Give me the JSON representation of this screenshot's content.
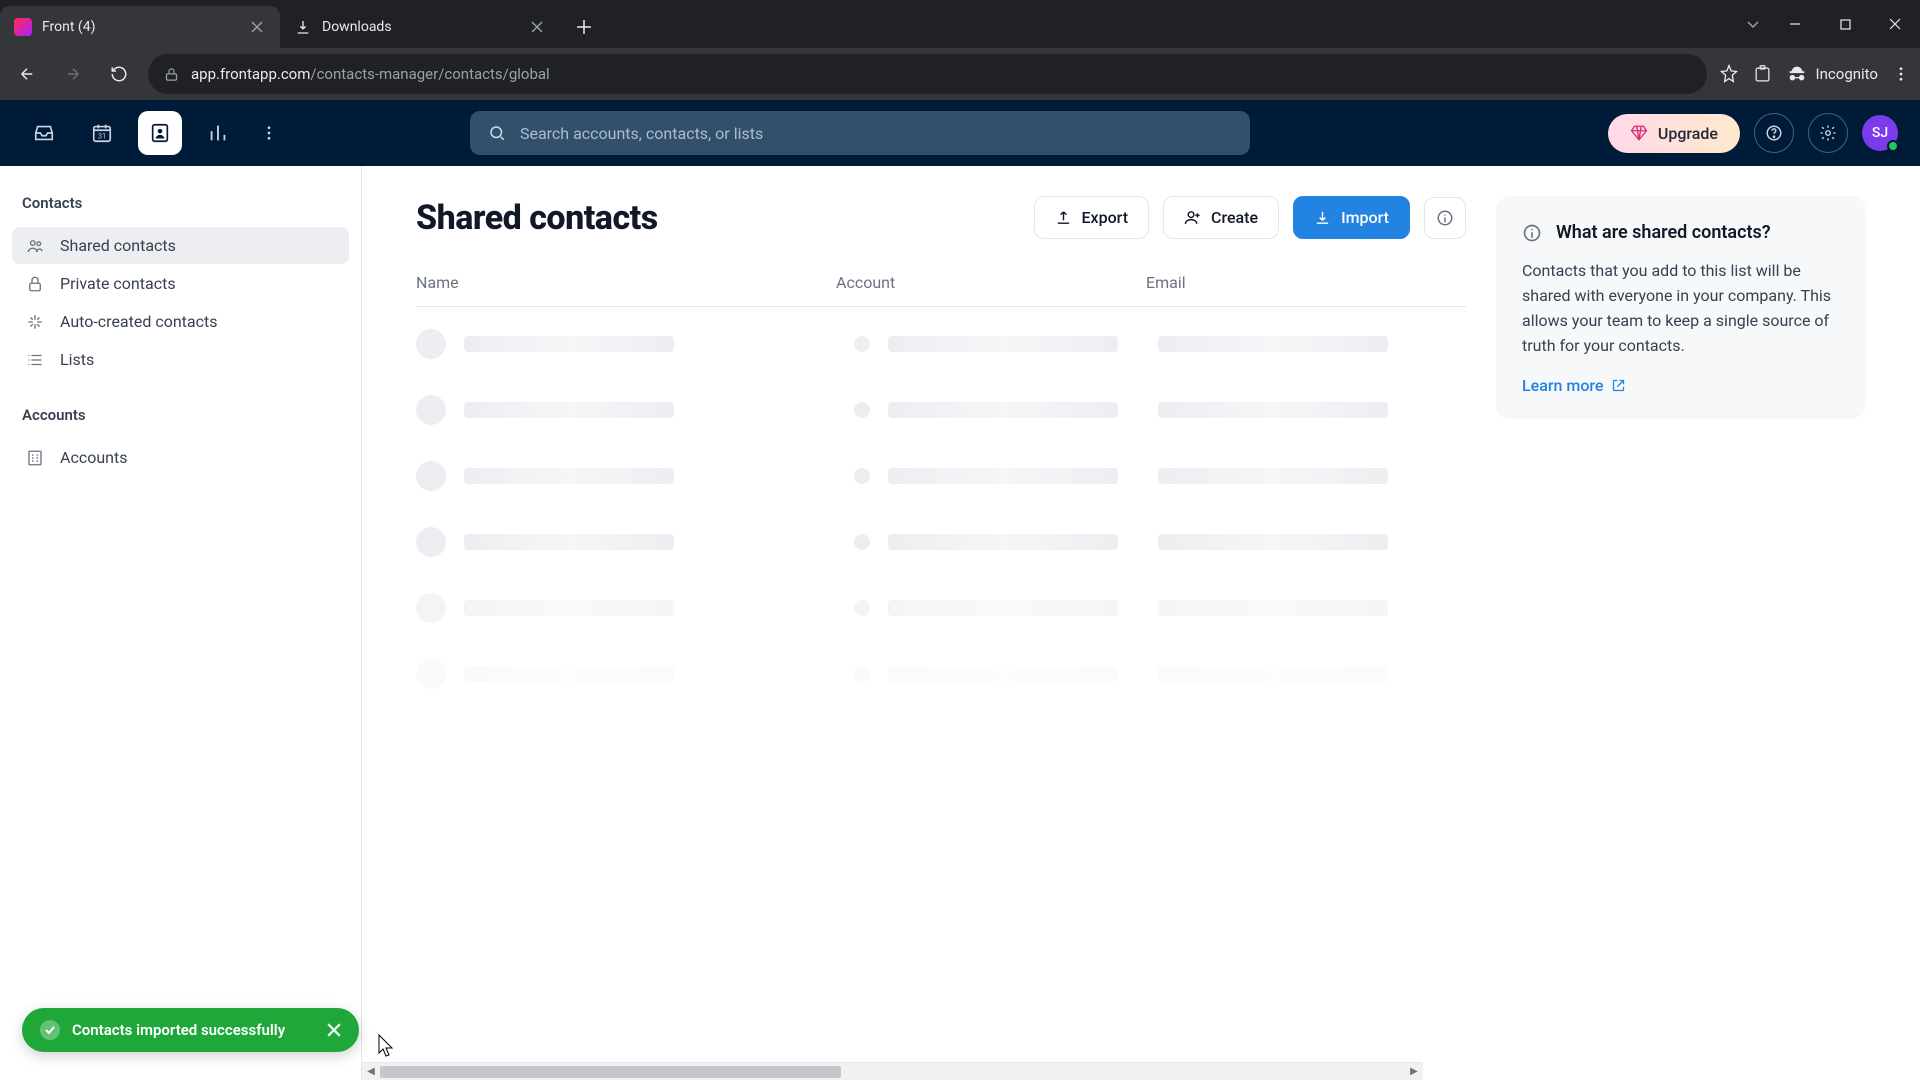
{
  "browser": {
    "tabs": [
      {
        "title": "Front (4)",
        "favicon": "front"
      },
      {
        "title": "Downloads",
        "favicon": "download"
      }
    ],
    "url_host": "app.frontapp.com",
    "url_path": "/contacts-manager/contacts/global",
    "incognito_label": "Incognito"
  },
  "app_header": {
    "search_placeholder": "Search accounts, contacts, or lists",
    "upgrade_label": "Upgrade",
    "avatar_initials": "SJ"
  },
  "sidebar": {
    "contacts_heading": "Contacts",
    "items": [
      {
        "label": "Shared contacts"
      },
      {
        "label": "Private contacts"
      },
      {
        "label": "Auto-created contacts"
      },
      {
        "label": "Lists"
      }
    ],
    "accounts_heading": "Accounts",
    "accounts_item": "Accounts"
  },
  "page": {
    "title": "Shared contacts",
    "export_label": "Export",
    "create_label": "Create",
    "import_label": "Import",
    "columns": {
      "name": "Name",
      "account": "Account",
      "email": "Email"
    }
  },
  "aside": {
    "title": "What are shared contacts?",
    "body": "Contacts that you add to this list will be shared with everyone in your company. This allows your team to keep a single source of truth for your contacts.",
    "learn_more": "Learn more"
  },
  "toast": {
    "message": "Contacts imported successfully"
  }
}
